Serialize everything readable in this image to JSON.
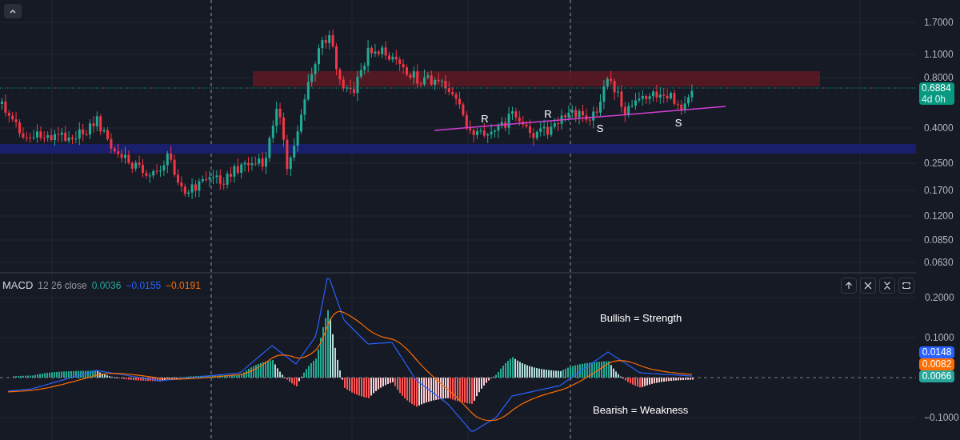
{
  "price_axis": {
    "labels": [
      "1.7000",
      "1.1000",
      "0.8000",
      "0.4000",
      "0.2500",
      "0.1700",
      "0.1200",
      "0.0850",
      "0.0630"
    ]
  },
  "price_tag": {
    "price": "0.6884",
    "countdown": "4d 0h"
  },
  "annotations": [
    {
      "text": "R"
    },
    {
      "text": "R"
    },
    {
      "text": "S"
    },
    {
      "text": "S"
    }
  ],
  "macd": {
    "title": "MACD",
    "params": "12 26 close",
    "values": [
      {
        "text": "0.0036",
        "color": "#26a69a"
      },
      {
        "text": "−0.0155",
        "color": "#2962ff"
      },
      {
        "text": "−0.0191",
        "color": "#ff6d00"
      }
    ],
    "axis_labels": [
      "0.2000",
      "0.1000",
      "−0.1000"
    ],
    "tags": [
      {
        "text": "0.0148",
        "color": "#2962ff"
      },
      {
        "text": "0.0082",
        "color": "#ff6d00"
      },
      {
        "text": "0.0066",
        "color": "#26a69a"
      }
    ],
    "notes": [
      {
        "text": "Bullish = Strength"
      },
      {
        "text": "Bearish = Weakness"
      }
    ]
  }
}
